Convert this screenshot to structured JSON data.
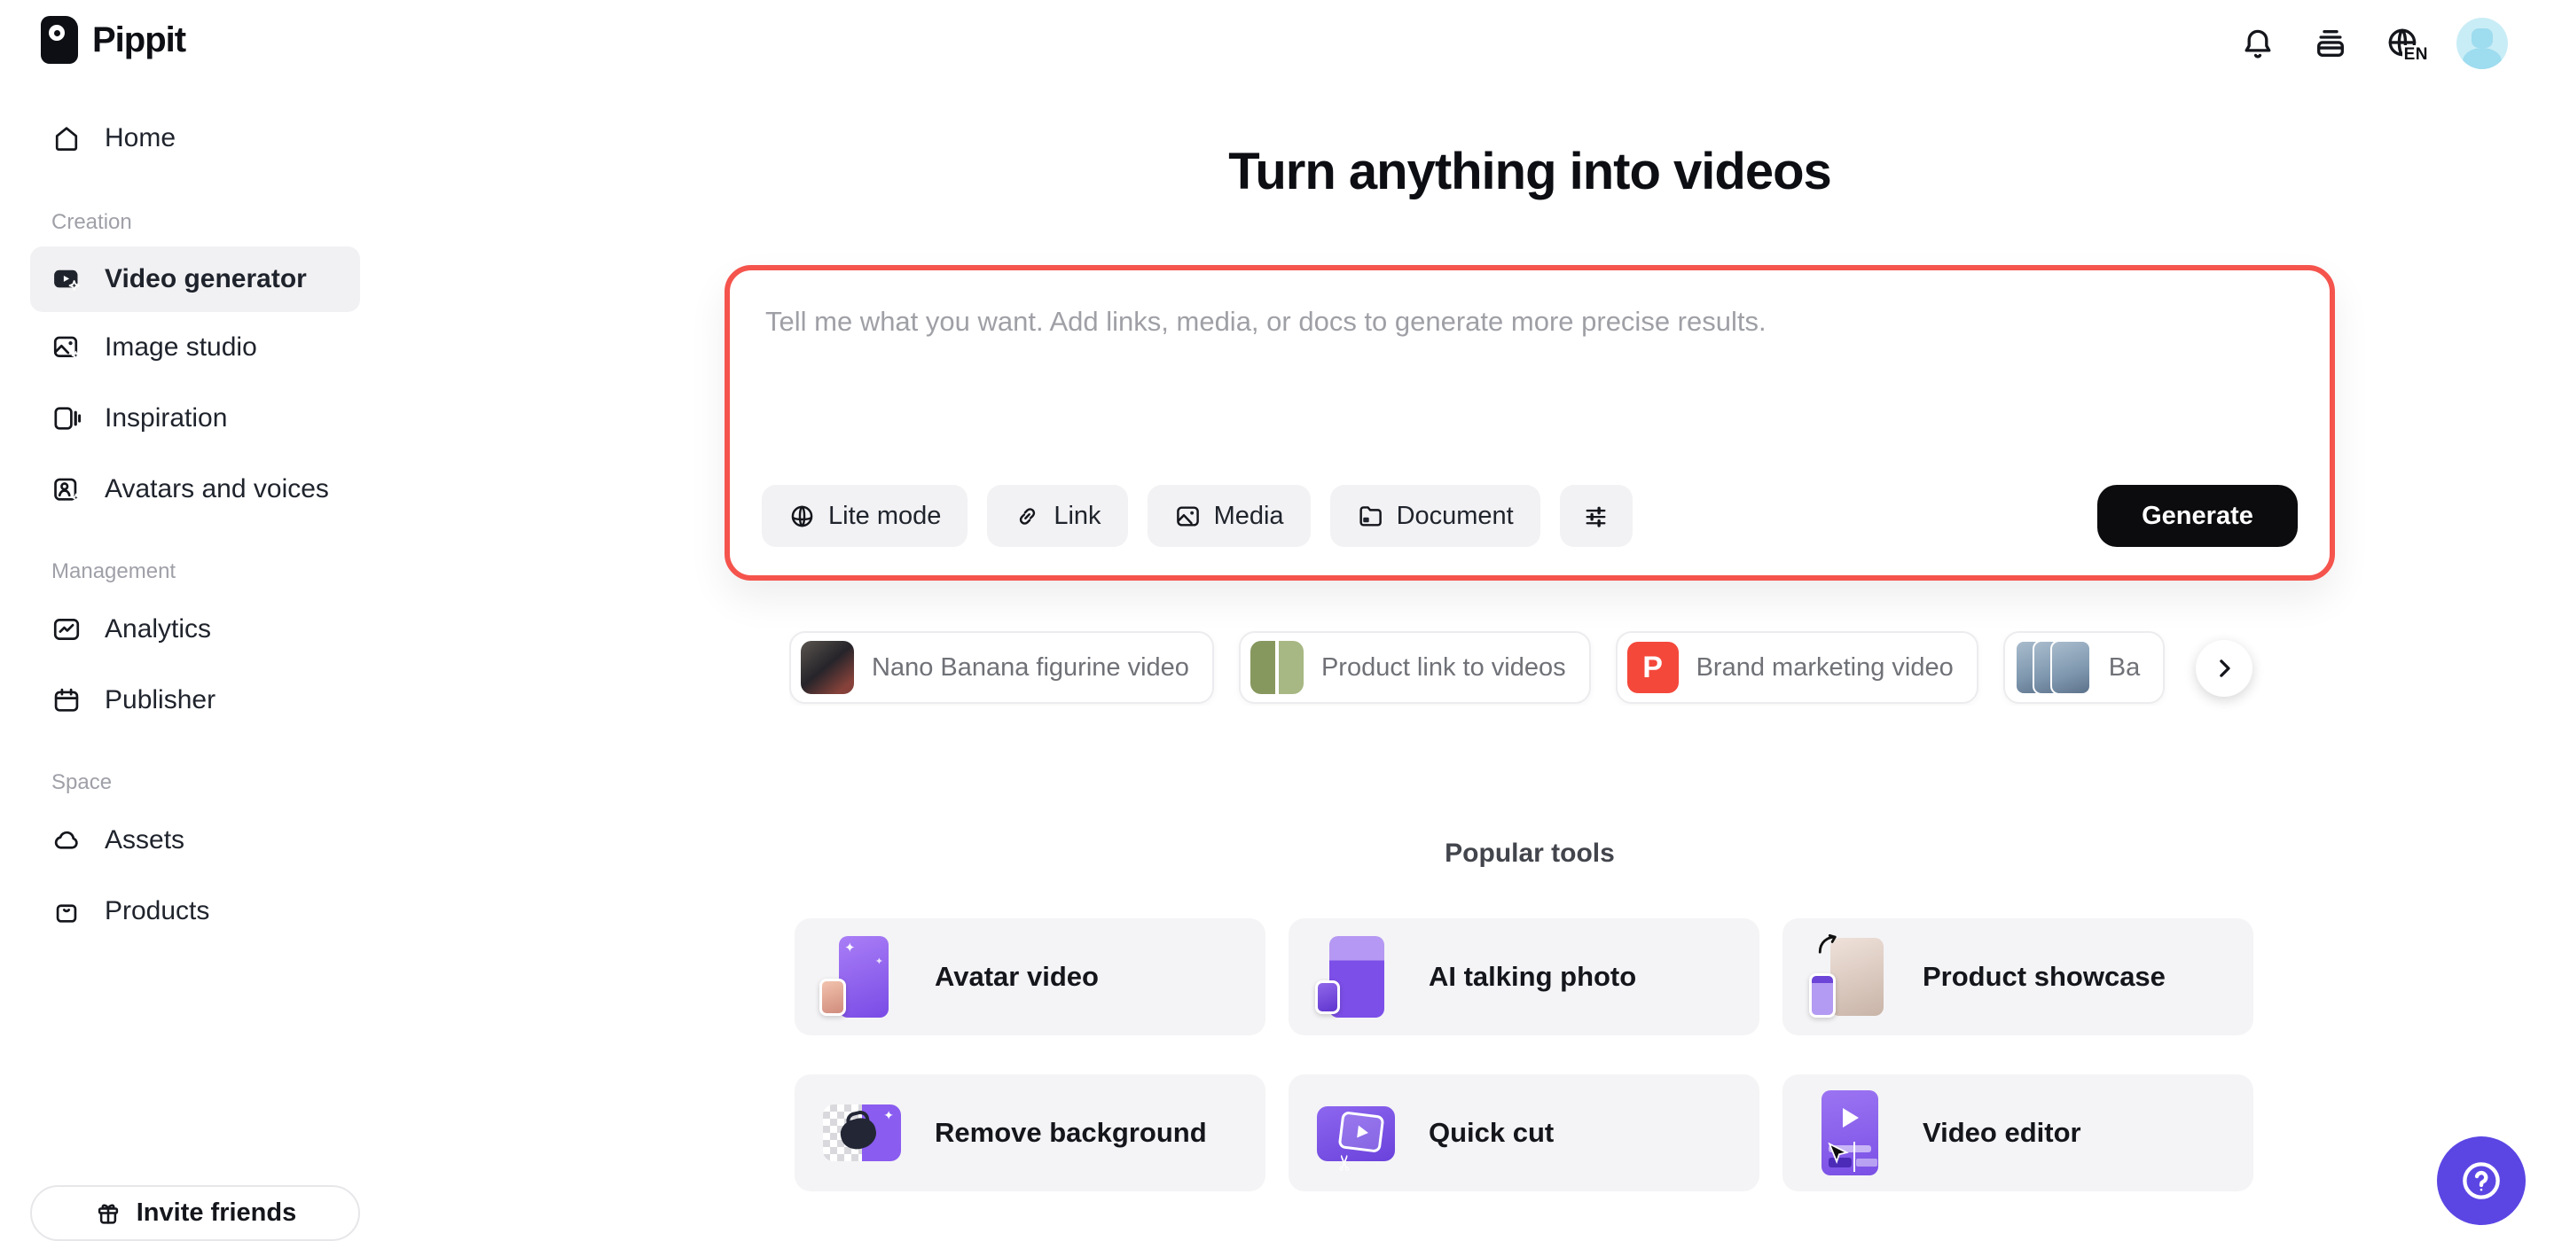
{
  "brand": {
    "name": "Pippit"
  },
  "topbar": {
    "language": "EN",
    "icons": [
      "bell-icon",
      "archive-stack-icon",
      "globe-language-icon",
      "user-avatar"
    ]
  },
  "sidebar": {
    "home_label": "Home",
    "sections": [
      {
        "label": "Creation",
        "items": [
          {
            "label": "Video generator",
            "active": true
          },
          {
            "label": "Image studio",
            "active": false
          },
          {
            "label": "Inspiration",
            "active": false
          },
          {
            "label": "Avatars and voices",
            "active": false
          }
        ]
      },
      {
        "label": "Management",
        "items": [
          {
            "label": "Analytics",
            "active": false
          },
          {
            "label": "Publisher",
            "active": false
          }
        ]
      },
      {
        "label": "Space",
        "items": [
          {
            "label": "Assets",
            "active": false
          },
          {
            "label": "Products",
            "active": false
          }
        ]
      }
    ],
    "invite_label": "Invite friends"
  },
  "main": {
    "title": "Turn anything into videos",
    "composer": {
      "placeholder": "Tell me what you want. Add links, media, or docs to generate more precise results.",
      "value": "",
      "buttons": {
        "lite_mode": "Lite mode",
        "link": "Link",
        "media": "Media",
        "document": "Document"
      },
      "generate_label": "Generate"
    },
    "suggestions": [
      {
        "label": "Nano Banana figurine video"
      },
      {
        "label": "Product link to videos"
      },
      {
        "label": "Brand marketing video",
        "badge": "P"
      },
      {
        "label": "Ba",
        "truncated": true
      }
    ],
    "popular": {
      "title": "Popular tools",
      "tools": [
        {
          "label": "Avatar video"
        },
        {
          "label": "AI talking photo"
        },
        {
          "label": "Product showcase"
        },
        {
          "label": "Remove background"
        },
        {
          "label": "Quick cut"
        },
        {
          "label": "Video editor"
        }
      ]
    }
  },
  "colors": {
    "accent_red": "#F5544D",
    "generate_black": "#0C0C0E",
    "help_purple": "#5B46E4",
    "chip_badge_red": "#F4483B",
    "avatar_bg": "#C9EDF6",
    "active_item_bg": "#F1F1F3"
  }
}
